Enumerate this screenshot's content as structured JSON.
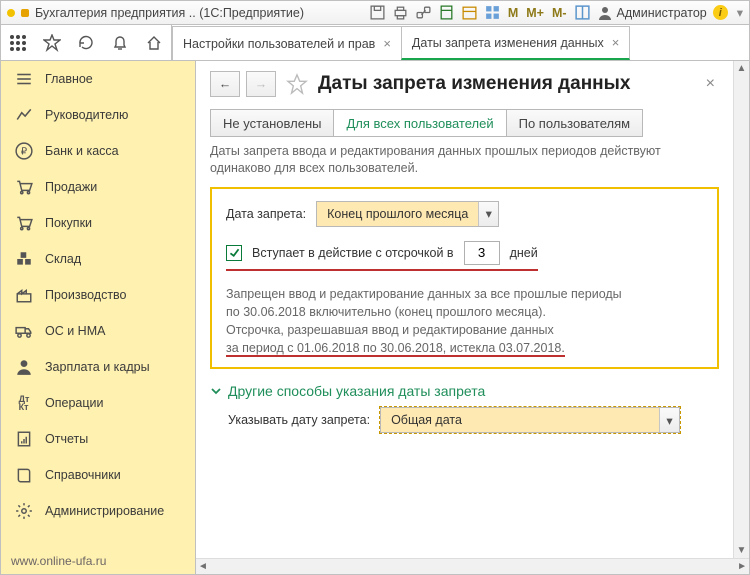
{
  "window": {
    "title": "Бухгалтерия предприятия .. (1С:Предприятие)",
    "m": "M",
    "mplus": "M+",
    "mminus": "M-",
    "user": "Администратор"
  },
  "tabs": [
    {
      "label": "Настройки пользователей и прав"
    },
    {
      "label": "Даты запрета изменения данных"
    }
  ],
  "sidebar": [
    "Главное",
    "Руководителю",
    "Банк и касса",
    "Продажи",
    "Покупки",
    "Склад",
    "Производство",
    "ОС и НМА",
    "Зарплата и кадры",
    "Операции",
    "Отчеты",
    "Справочники",
    "Администрирование"
  ],
  "footer": "www.online-ufa.ru",
  "page": {
    "title": "Даты запрета изменения данных",
    "desc": "Даты запрета ввода и редактирования данных прошлых периодов действуют одинаково для всех пользователей."
  },
  "seg": [
    "Не установлены",
    "Для всех пользователей",
    "По пользователям"
  ],
  "form": {
    "label_date": "Дата запрета:",
    "date_value": "Конец прошлого месяца",
    "delay_label": "Вступает в действие с отсрочкой в",
    "delay_days": "3",
    "days": "дней",
    "info1": "Запрещен ввод и редактирование данных за все прошлые периоды",
    "info2": "по 30.06.2018 включительно (конец прошлого месяца).",
    "info3": "Отсрочка, разрешавшая ввод и редактирование данных",
    "info4": "за период с 01.06.2018 по 30.06.2018, истекла 03.07.2018."
  },
  "other": {
    "title": "Другие способы указания даты запрета",
    "label": "Указывать дату запрета:",
    "value": "Общая дата"
  }
}
